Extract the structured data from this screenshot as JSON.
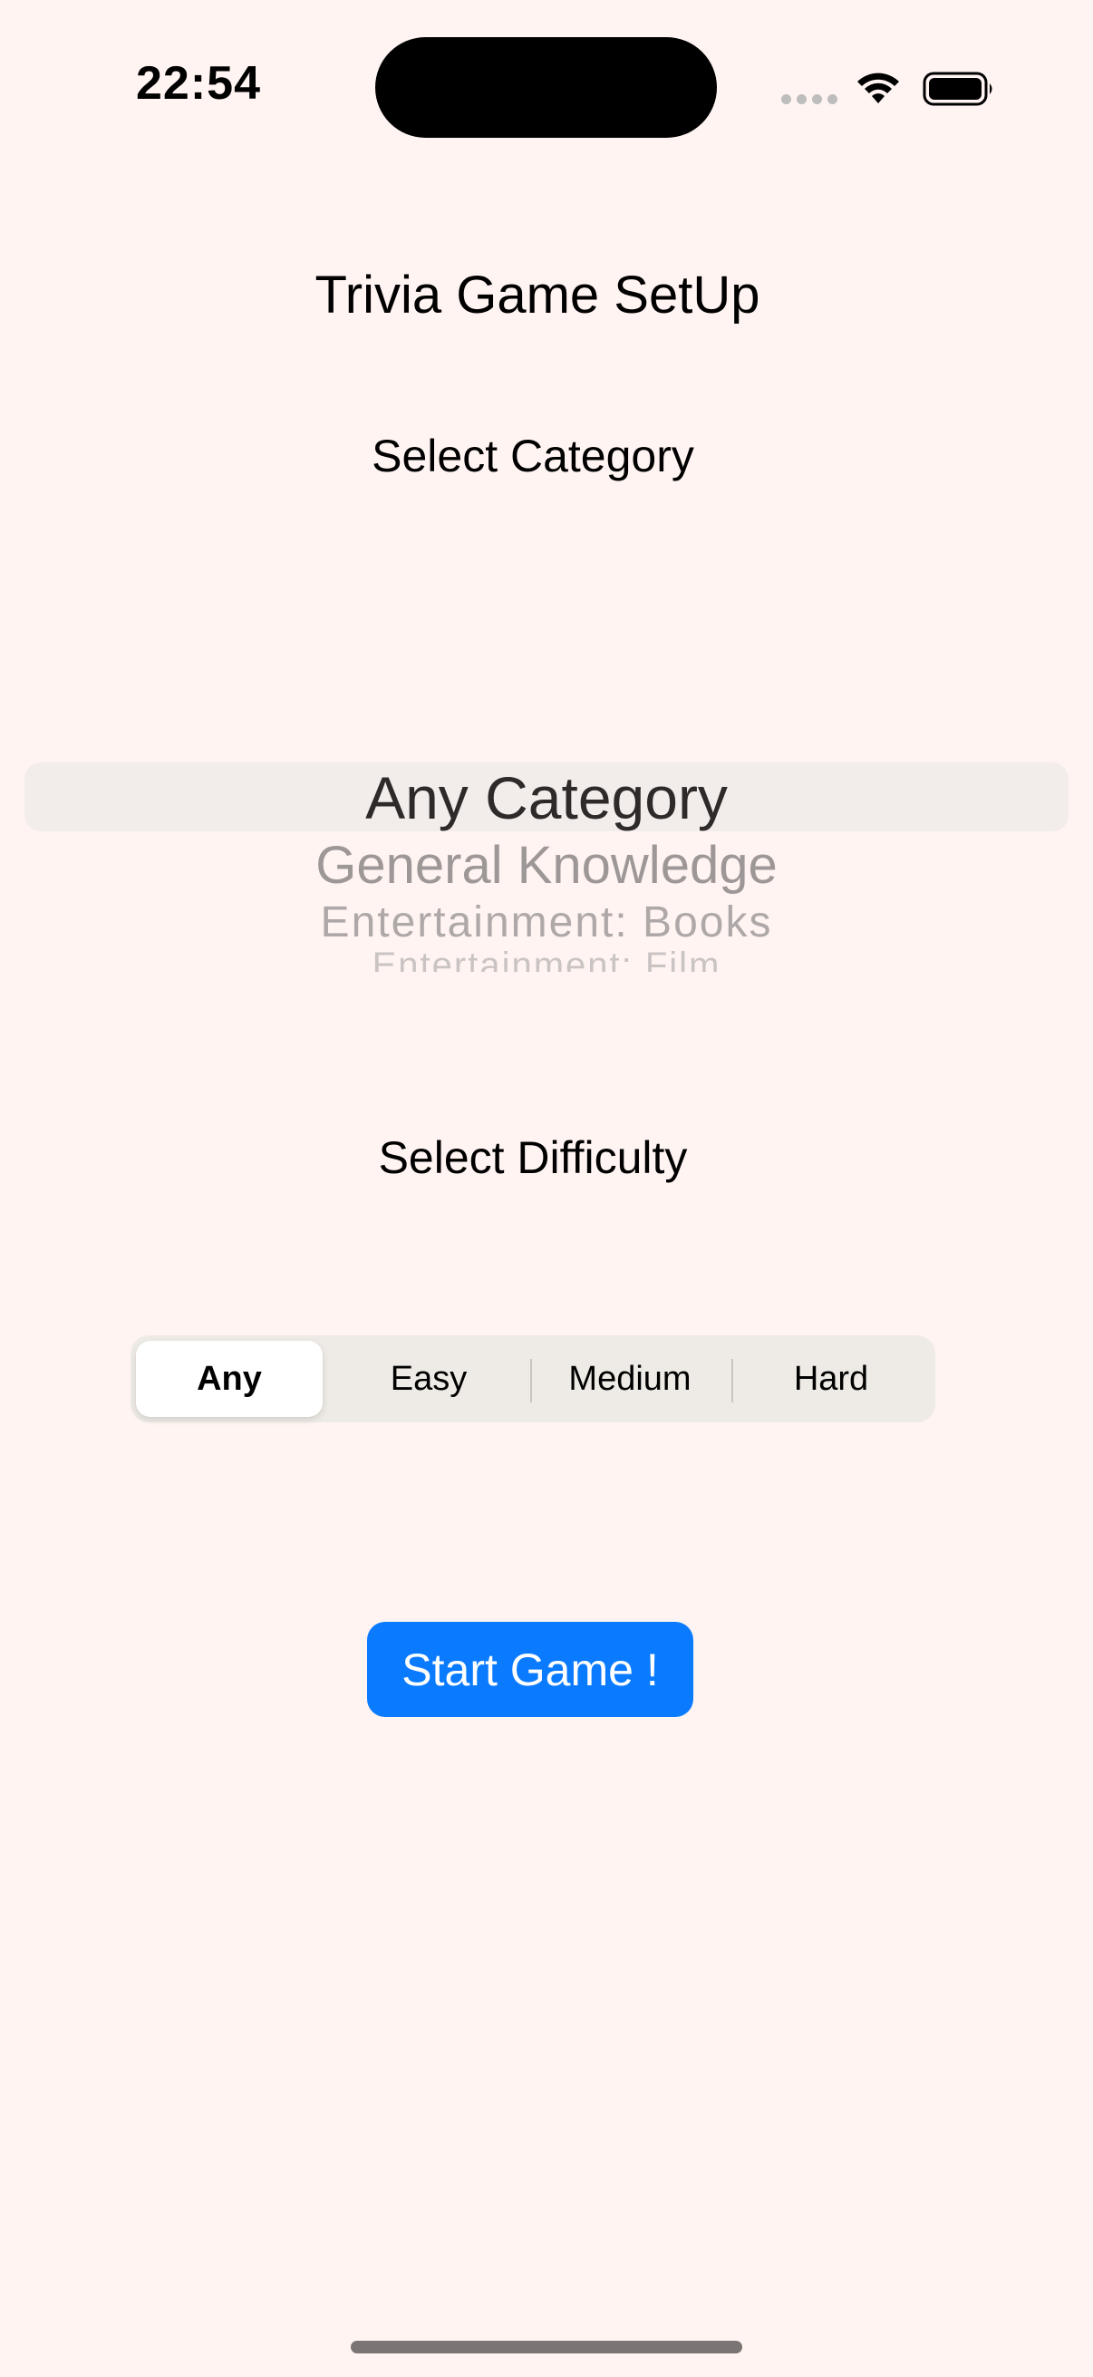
{
  "status_bar": {
    "time": "22:54",
    "icons": [
      "cellular-signal-icon",
      "wifi-icon",
      "battery-icon"
    ]
  },
  "title": "Trivia Game SetUp",
  "category": {
    "label": "Select Category",
    "picker_items": [
      "Any Category",
      "General Knowledge",
      "Entertainment: Books",
      "Entertainment: Film"
    ],
    "selected": "Any Category"
  },
  "difficulty": {
    "label": "Select Difficulty",
    "options": [
      "Any",
      "Easy",
      "Medium",
      "Hard"
    ],
    "selected": "Any"
  },
  "start_button": {
    "label": "Start Game !"
  },
  "colors": {
    "background": "#FFF4F2",
    "accent": "#0A7BFF",
    "segmented_bg": "#EEEBE6",
    "picker_highlight": "#F2ECEB"
  }
}
